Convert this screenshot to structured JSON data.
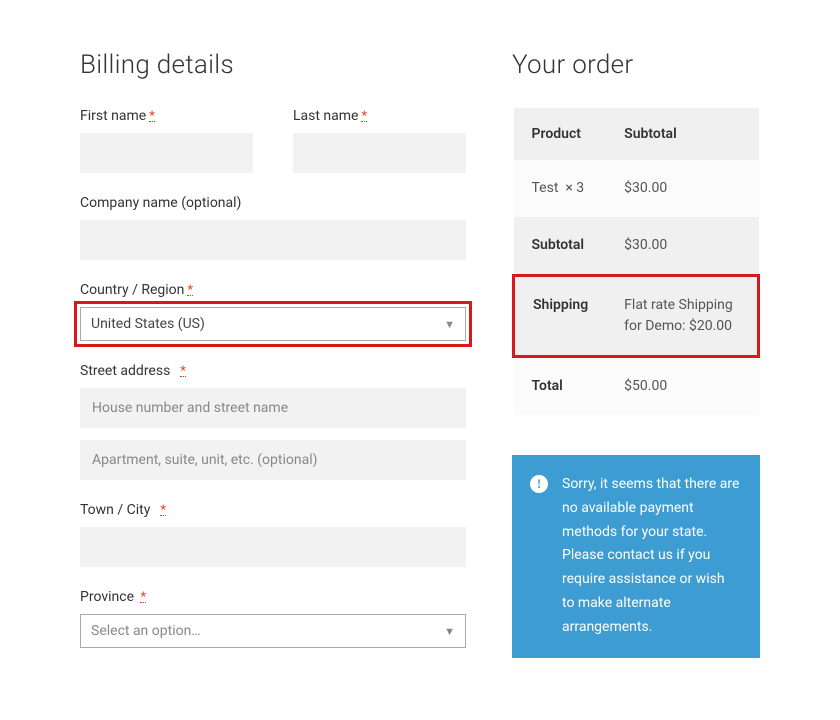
{
  "billing": {
    "title": "Billing details",
    "first_name_label": "First name",
    "last_name_label": "Last name",
    "company_label": "Company name (optional)",
    "country_label": "Country / Region",
    "country_value": "United States (US)",
    "street_label": "Street address",
    "street1_placeholder": "House number and street name",
    "street2_placeholder": "Apartment, suite, unit, etc. (optional)",
    "city_label": "Town / City",
    "province_label": "Province",
    "province_placeholder": "Select an option…",
    "required_mark": "*"
  },
  "order": {
    "title": "Your order",
    "header_product": "Product",
    "header_subtotal": "Subtotal",
    "item_name": "Test",
    "item_qty": "× 3",
    "item_subtotal": "$30.00",
    "subtotal_label": "Subtotal",
    "subtotal_value": "$30.00",
    "shipping_label": "Shipping",
    "shipping_value": "Flat rate Shipping for Demo: $20.00",
    "total_label": "Total",
    "total_value": "$50.00"
  },
  "alert": {
    "icon_text": "!",
    "message": "Sorry, it seems that there are no available payment methods for your state. Please contact us if you require assistance or wish to make alternate arrangements."
  }
}
